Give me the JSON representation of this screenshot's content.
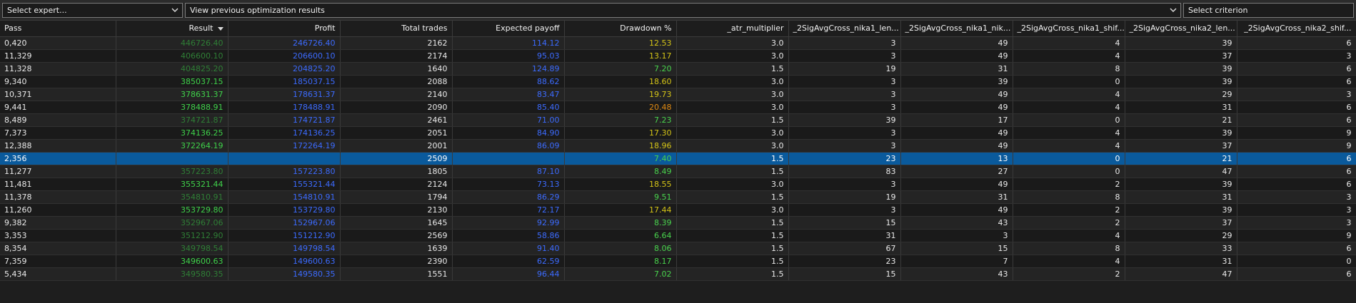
{
  "toolbar": {
    "expert": "Select expert...",
    "results": "View previous optimization results",
    "criterion": "Select criterion"
  },
  "colors": {
    "result_bright": "#3fd24a",
    "result_dim": "#2f7f36",
    "profit": "#3c6bff",
    "payoff": "#3c6bff",
    "dd_green": "#49d44d",
    "dd_yellow": "#d4c417",
    "dd_orange": "#e08a12"
  },
  "columns": [
    "Pass",
    "Result",
    "Profit",
    "Total trades",
    "Expected payoff",
    "Drawdown %",
    "_atr_multiplier",
    "_2SigAvgCross_nika1_len...",
    "_2SigAvgCross_nika1_nik...",
    "_2SigAvgCross_nika1_shif...",
    "_2SigAvgCross_nika2_len...",
    "_2SigAvgCross_nika2_shif..."
  ],
  "rows": [
    {
      "pass": "0,420",
      "result": "446726.40",
      "profit": "246726.40",
      "trades": "2162",
      "payoff": "114.12",
      "dd": "12.53",
      "atr": "3.0",
      "n1len": "3",
      "n1nik": "49",
      "n1shif": "4",
      "n2len": "39",
      "n2shif": "6",
      "rstyle": "dim",
      "dstyle": "yellow"
    },
    {
      "pass": "11,329",
      "result": "406600.10",
      "profit": "206600.10",
      "trades": "2174",
      "payoff": "95.03",
      "dd": "13.17",
      "atr": "3.0",
      "n1len": "3",
      "n1nik": "49",
      "n1shif": "4",
      "n2len": "37",
      "n2shif": "3",
      "rstyle": "dim",
      "dstyle": "yellow"
    },
    {
      "pass": "11,328",
      "result": "404825.20",
      "profit": "204825.20",
      "trades": "1640",
      "payoff": "124.89",
      "dd": "7.20",
      "atr": "1.5",
      "n1len": "19",
      "n1nik": "31",
      "n1shif": "8",
      "n2len": "39",
      "n2shif": "6",
      "rstyle": "dim",
      "dstyle": "green"
    },
    {
      "pass": "9,340",
      "result": "385037.15",
      "profit": "185037.15",
      "trades": "2088",
      "payoff": "88.62",
      "dd": "18.60",
      "atr": "3.0",
      "n1len": "3",
      "n1nik": "39",
      "n1shif": "0",
      "n2len": "39",
      "n2shif": "6",
      "rstyle": "bright",
      "dstyle": "yellow"
    },
    {
      "pass": "10,371",
      "result": "378631.37",
      "profit": "178631.37",
      "trades": "2140",
      "payoff": "83.47",
      "dd": "19.73",
      "atr": "3.0",
      "n1len": "3",
      "n1nik": "49",
      "n1shif": "4",
      "n2len": "29",
      "n2shif": "3",
      "rstyle": "bright",
      "dstyle": "yellow"
    },
    {
      "pass": "9,441",
      "result": "378488.91",
      "profit": "178488.91",
      "trades": "2090",
      "payoff": "85.40",
      "dd": "20.48",
      "atr": "3.0",
      "n1len": "3",
      "n1nik": "49",
      "n1shif": "4",
      "n2len": "31",
      "n2shif": "6",
      "rstyle": "bright",
      "dstyle": "orange"
    },
    {
      "pass": "8,489",
      "result": "374721.87",
      "profit": "174721.87",
      "trades": "2461",
      "payoff": "71.00",
      "dd": "7.23",
      "atr": "1.5",
      "n1len": "39",
      "n1nik": "17",
      "n1shif": "0",
      "n2len": "21",
      "n2shif": "6",
      "rstyle": "dim",
      "dstyle": "green"
    },
    {
      "pass": "7,373",
      "result": "374136.25",
      "profit": "174136.25",
      "trades": "2051",
      "payoff": "84.90",
      "dd": "17.30",
      "atr": "3.0",
      "n1len": "3",
      "n1nik": "49",
      "n1shif": "4",
      "n2len": "39",
      "n2shif": "9",
      "rstyle": "bright",
      "dstyle": "yellow"
    },
    {
      "pass": "12,388",
      "result": "372264.19",
      "profit": "172264.19",
      "trades": "2001",
      "payoff": "86.09",
      "dd": "18.96",
      "atr": "3.0",
      "n1len": "3",
      "n1nik": "49",
      "n1shif": "4",
      "n2len": "37",
      "n2shif": "9",
      "rstyle": "bright",
      "dstyle": "yellow"
    },
    {
      "pass": "2,356",
      "result": "",
      "profit": "",
      "trades": "2509",
      "payoff": "",
      "dd": "7.40",
      "atr": "1.5",
      "n1len": "23",
      "n1nik": "13",
      "n1shif": "0",
      "n2len": "21",
      "n2shif": "6",
      "rstyle": "dim",
      "dstyle": "green",
      "selected": true
    },
    {
      "pass": "11,277",
      "result": "357223.80",
      "profit": "157223.80",
      "trades": "1805",
      "payoff": "87.10",
      "dd": "8.49",
      "atr": "1.5",
      "n1len": "83",
      "n1nik": "27",
      "n1shif": "0",
      "n2len": "47",
      "n2shif": "6",
      "rstyle": "dim",
      "dstyle": "green"
    },
    {
      "pass": "11,481",
      "result": "355321.44",
      "profit": "155321.44",
      "trades": "2124",
      "payoff": "73.13",
      "dd": "18.55",
      "atr": "3.0",
      "n1len": "3",
      "n1nik": "49",
      "n1shif": "2",
      "n2len": "39",
      "n2shif": "6",
      "rstyle": "bright",
      "dstyle": "yellow"
    },
    {
      "pass": "11,378",
      "result": "354810.91",
      "profit": "154810.91",
      "trades": "1794",
      "payoff": "86.29",
      "dd": "9.51",
      "atr": "1.5",
      "n1len": "19",
      "n1nik": "31",
      "n1shif": "8",
      "n2len": "31",
      "n2shif": "3",
      "rstyle": "dim",
      "dstyle": "green"
    },
    {
      "pass": "11,260",
      "result": "353729.80",
      "profit": "153729.80",
      "trades": "2130",
      "payoff": "72.17",
      "dd": "17.44",
      "atr": "3.0",
      "n1len": "3",
      "n1nik": "49",
      "n1shif": "2",
      "n2len": "39",
      "n2shif": "3",
      "rstyle": "bright",
      "dstyle": "yellow"
    },
    {
      "pass": "9,382",
      "result": "352967.06",
      "profit": "152967.06",
      "trades": "1645",
      "payoff": "92.99",
      "dd": "8.39",
      "atr": "1.5",
      "n1len": "15",
      "n1nik": "43",
      "n1shif": "2",
      "n2len": "37",
      "n2shif": "3",
      "rstyle": "dim",
      "dstyle": "green"
    },
    {
      "pass": "3,353",
      "result": "351212.90",
      "profit": "151212.90",
      "trades": "2569",
      "payoff": "58.86",
      "dd": "6.64",
      "atr": "1.5",
      "n1len": "31",
      "n1nik": "3",
      "n1shif": "4",
      "n2len": "29",
      "n2shif": "9",
      "rstyle": "dim",
      "dstyle": "green"
    },
    {
      "pass": "8,354",
      "result": "349798.54",
      "profit": "149798.54",
      "trades": "1639",
      "payoff": "91.40",
      "dd": "8.06",
      "atr": "1.5",
      "n1len": "67",
      "n1nik": "15",
      "n1shif": "8",
      "n2len": "33",
      "n2shif": "6",
      "rstyle": "dim",
      "dstyle": "green"
    },
    {
      "pass": "7,359",
      "result": "349600.63",
      "profit": "149600.63",
      "trades": "2390",
      "payoff": "62.59",
      "dd": "8.17",
      "atr": "1.5",
      "n1len": "23",
      "n1nik": "7",
      "n1shif": "4",
      "n2len": "31",
      "n2shif": "0",
      "rstyle": "bright",
      "dstyle": "green"
    },
    {
      "pass": "5,434",
      "result": "349580.35",
      "profit": "149580.35",
      "trades": "1551",
      "payoff": "96.44",
      "dd": "7.02",
      "atr": "1.5",
      "n1len": "15",
      "n1nik": "43",
      "n1shif": "2",
      "n2len": "47",
      "n2shif": "6",
      "rstyle": "dim",
      "dstyle": "green"
    }
  ]
}
